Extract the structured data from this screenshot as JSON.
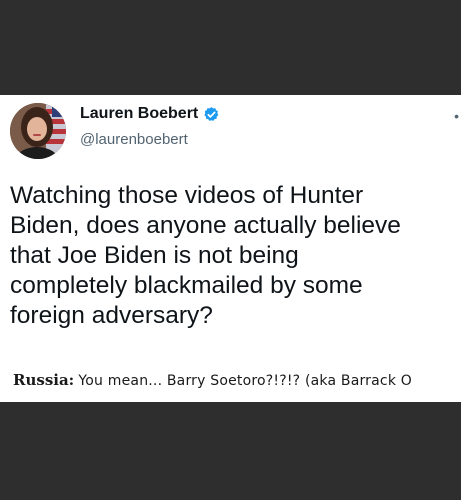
{
  "tweet": {
    "display_name": "Lauren Boebert",
    "handle": "@laurenboebert",
    "text": "Watching those videos of Hunter\nBiden, does anyone actually believe\nthat Joe Biden is not being\ncompletely blackmailed by some\nforeign adversary?"
  },
  "reply": {
    "author": "Russia:",
    "text": "You mean... Barry Soetoro?!?!? (aka Barrack O"
  },
  "icons": {
    "verified": "verified-badge-icon",
    "more": "more-options-icon"
  },
  "colors": {
    "verified_blue": "#1d9bf0",
    "background_dark": "#2e2e2e"
  }
}
